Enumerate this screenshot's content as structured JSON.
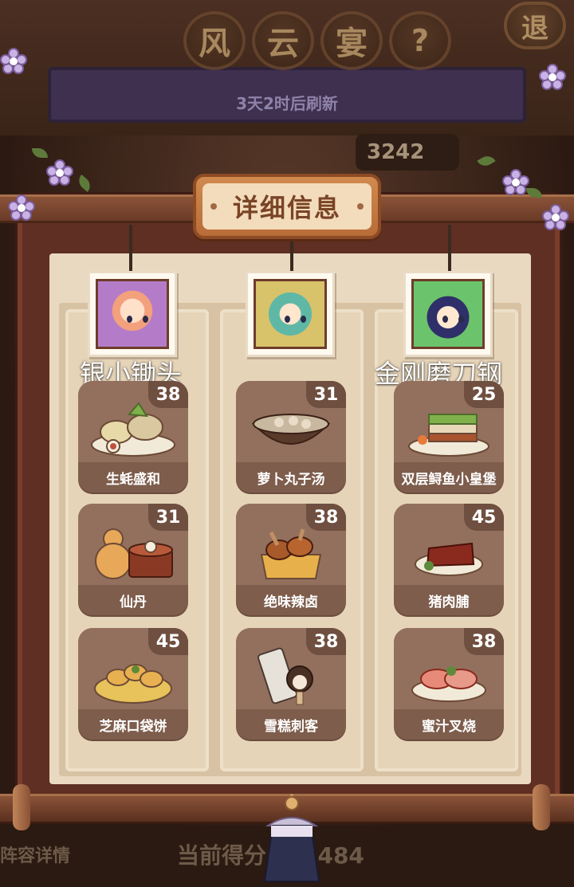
{
  "header": {
    "title_chars": [
      "风",
      "云",
      "宴"
    ],
    "help_label": "?",
    "exit_label": "退",
    "refresh_text": "3天2时后刷新",
    "top_score": "3242"
  },
  "dialog": {
    "title": "详细信息"
  },
  "chefs": [
    {
      "name": "银小锄头",
      "dishes": [
        {
          "name": "生蚝盛和",
          "score": "38"
        },
        {
          "name": "仙丹",
          "score": "31"
        },
        {
          "name": "芝麻口袋饼",
          "score": "45"
        }
      ]
    },
    {
      "name": "",
      "dishes": [
        {
          "name": "萝卜丸子汤",
          "score": "31"
        },
        {
          "name": "绝味辣卤",
          "score": "38"
        },
        {
          "name": "雪糕刺客",
          "score": "38"
        }
      ]
    },
    {
      "name": "金刚磨刀钢",
      "dishes": [
        {
          "name": "双层鲟鱼小皇堡",
          "score": "25"
        },
        {
          "name": "猪肉脯",
          "score": "45"
        },
        {
          "name": "蜜汁叉烧",
          "score": "38"
        }
      ]
    }
  ],
  "footer": {
    "lineup_label": "阵容详情",
    "current_score_label": "当前得分",
    "current_score_value": "201484"
  },
  "colors": {
    "frame": "#5e2f22",
    "paper": "#e9d9c0",
    "card": "#8c6a58",
    "plaque": "#b86c38"
  }
}
